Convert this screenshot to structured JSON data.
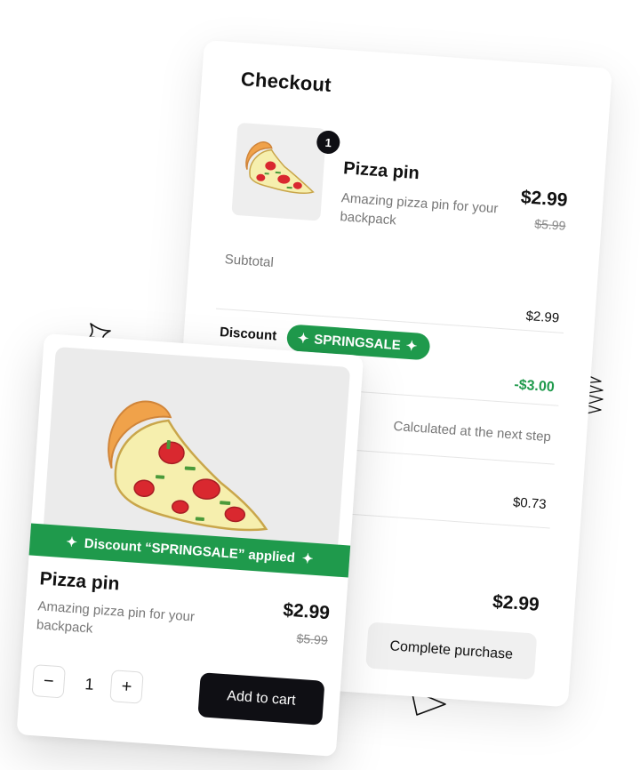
{
  "checkout": {
    "title": "Checkout",
    "item": {
      "quantity": "1",
      "name": "Pizza pin",
      "description": "Amazing pizza pin for your backpack",
      "price": "$2.99",
      "original_price": "$5.99"
    },
    "subtotal": {
      "label": "Subtotal",
      "value": "$2.99"
    },
    "discount": {
      "label": "Discount",
      "code": "SPRINGSALE",
      "value": "-$3.00"
    },
    "shipping_value": "Calculated at the next step",
    "tax_value": "$0.73",
    "total_value": "$2.99",
    "complete_label": "Complete purchase"
  },
  "product": {
    "banner": "Discount “SPRINGSALE” applied",
    "name": "Pizza pin",
    "description": "Amazing pizza pin for your backpack",
    "price": "$2.99",
    "original_price": "$5.99",
    "quantity": "1",
    "decrement_label": "−",
    "increment_label": "+",
    "add_to_cart_label": "Add to cart"
  },
  "colors": {
    "accent_green": "#1f9a4c",
    "dark_button": "#0f0f14"
  },
  "icons": [
    "sparkle-icon",
    "pizza-pin-image"
  ]
}
